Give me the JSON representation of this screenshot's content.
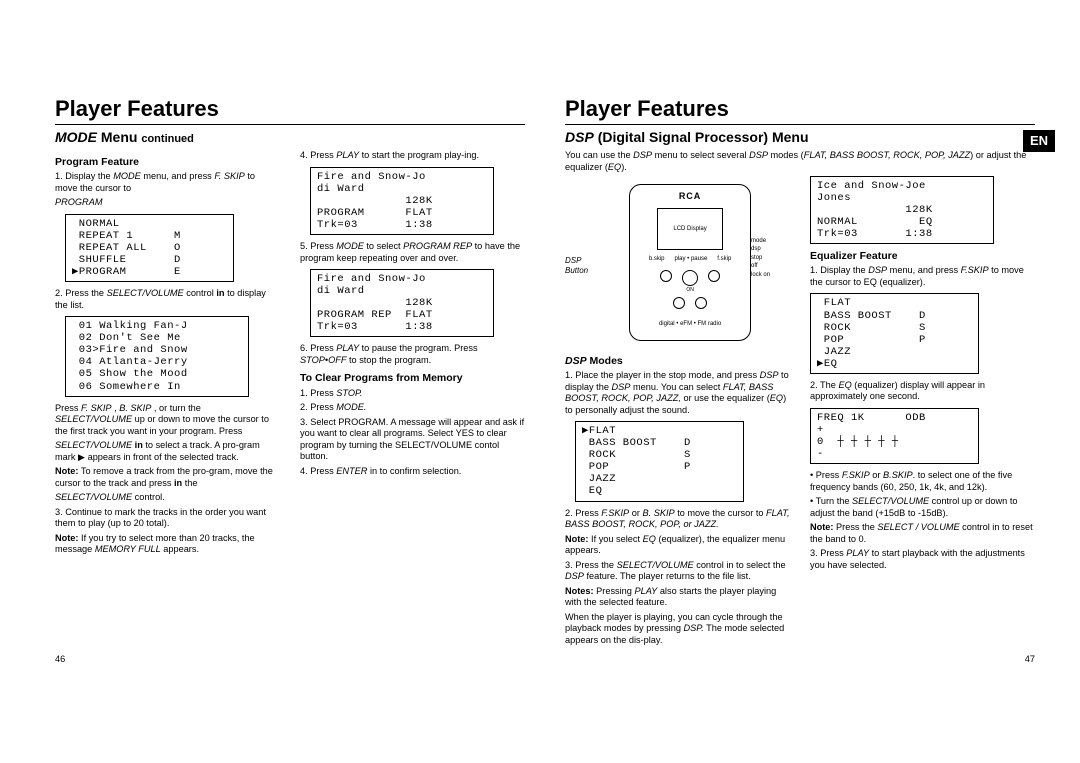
{
  "left": {
    "title": "Player Features",
    "section": "MODE Menu continued",
    "section_italic": "MODE",
    "sub_program": "Program Feature",
    "p1a": "1. Display the ",
    "p1b": "MODE",
    "p1c": " menu, and press ",
    "p1d": "F. SKIP",
    "p1e": " to move the cursor to",
    "p1f": "PROGRAM",
    "lcd1": " NORMAL\n REPEAT 1      M\n REPEAT ALL    O\n SHUFFLE       D\n▶PROGRAM       E",
    "p2a": "2. Press the ",
    "p2b": "SELECT/VOLUME",
    "p2c": " control ",
    "p2d": "in",
    "p2e": " to display the list.",
    "lcd2": " 01 Walking Fan-J\n 02 Don't See Me\n 03>Fire and Snow\n 04 Atlanta-Jerry\n 05 Show the Mood\n 06 Somewhere In",
    "p3a": "Press ",
    "p3b": "F. SKIP",
    "p3c": " , ",
    "p3d": "B. SKIP",
    "p3e": " , or turn the ",
    "p3f": "SELECT/VOLUME",
    "p3g": " up or down to move the cursor to the first track you want in your program. Press",
    "p4a": "SELECT/VOLUME",
    "p4b": " in",
    "p4c": " to select a track. A pro-gram mark ▶ appears in front of the selected track.",
    "p5a": "Note:",
    "p5b": " To remove a track from the pro-gram, move the cursor to the track and press ",
    "p5c": "in",
    "p5d": " the",
    "p5e": "SELECT/VOLUME",
    "p5f": " control.",
    "p6": "3. Continue to mark the tracks in the order you want them to play (up to 20 total).",
    "p7a": "Note:",
    "p7b": " If you try to select more than 20 tracks, the message ",
    "p7c": "MEMORY FULL",
    "p7d": " appears.",
    "r1a": "4. Press ",
    "r1b": "PLAY",
    "r1c": " to start the program play-ing.",
    "lcd3": "Fire and Snow-Jo\ndi Ward\n             128K\nPROGRAM      FLAT\nTrk=03       1:38",
    "r2a": "5. Press ",
    "r2b": "MODE",
    "r2c": " to select ",
    "r2d": "PROGRAM REP",
    "r2e": " to have the program keep repeating over and over.",
    "lcd4": "Fire and Snow-Jo\ndi Ward\n             128K\nPROGRAM REP  FLAT\nTrk=03       1:38",
    "r3a": "6. Press ",
    "r3b": "PLAY",
    "r3c": " to pause the program. Press ",
    "r3d": "STOP•OFF",
    "r3e": " to stop the program.",
    "sub_clear": "To Clear Programs from Memory",
    "c1a": "1. Press ",
    "c1b": "STOP.",
    "c2a": "2. Press ",
    "c2b": "MODE.",
    "c3": "3. Select PROGRAM. A message will appear and ask if you want to clear all programs. Select YES to clear program by turning the SELECT/VOLUME contol button.",
    "c4a": " 4. Press ",
    "c4b": "ENTER",
    "c4c": " in to confirm selection.",
    "pagenum": "46"
  },
  "right": {
    "title": "Player Features",
    "section": "DSP (Digital Signal Processor) Menu",
    "section_italic": "DSP",
    "intro1a": "You can use the ",
    "intro1b": "DSP",
    "intro1c": " menu to select several ",
    "intro1d": "DSP",
    "intro1e": " modes (",
    "intro1f": "FLAT, BASS BOOST, ROCK, POP, JAZZ",
    "intro1g": ") or adjust the equalizer (",
    "intro1h": "EQ",
    "intro1i": ").",
    "dsp_btn_label": "DSP\nButton",
    "dev_brand": "RCA",
    "dev_screen": "LCD Display",
    "dev_footer": "digital • eFM • FM radio",
    "dev_btn1": "b.skip",
    "dev_btn2": "play • pause",
    "dev_btn3": "f.skip",
    "dev_on": "ON",
    "dev_side": "mode\ndsp\nstop\noff\nlock on",
    "sub_dspmodes": "DSP Modes",
    "m1a": "1. Place the player in the stop mode, and press ",
    "m1b": "DSP",
    "m1c": " to display the ",
    "m1d": "DSP",
    "m1e": " menu. You can select ",
    "m1f": "FLAT, BASS BOOST, ROCK, POP, JAZZ,",
    "m1g": " or use the equalizer (",
    "m1h": "EQ",
    "m1i": ") to personally adjust the sound.",
    "lcd5": "▶FLAT\n BASS BOOST    D\n ROCK          S\n POP           P\n JAZZ\n EQ",
    "m2a": "2. Press ",
    "m2b": "F.SKIP",
    "m2c": " or ",
    "m2d": "B. SKIP",
    "m2e": " to move the cursor to ",
    "m2f": "FLAT, BASS BOOST, ROCK, POP, or JAZZ.",
    "m3a": "Note:",
    "m3b": " If you select ",
    "m3c": "EQ",
    "m3d": " (equalizer), the equalizer menu appears.",
    "m4a": "3. Press the ",
    "m4b": "SELECT/VOLUME",
    "m4c": " control in to select the ",
    "m4d": "DSP",
    "m4e": " feature. The player returns to the file list.",
    "m5a": "Notes:",
    "m5b": " Pressing ",
    "m5c": "PLAY",
    "m5d": " also starts the player playing with the selected feature.",
    "m6a": "When the player is playing, you can cycle through the playback modes by pressing ",
    "m6b": "DSP.",
    "m6c": " The mode selected appears on the dis-play.",
    "lcd6": "Ice and Snow-Joe\nJones\n             128K\nNORMAL         EQ\nTrk=03       1:38",
    "sub_eq": "Equalizer Feature",
    "e1a": "1. Display the ",
    "e1b": "DSP",
    "e1c": " menu, and press ",
    "e1d": "F.SKIP",
    "e1e": " to move the cursor to EQ (equalizer).",
    "lcd7": " FLAT\n BASS BOOST    D\n ROCK          S\n POP           P\n JAZZ\n▶EQ",
    "e2a": "2. The ",
    "e2b": "EQ",
    "e2c": " (equalizer) display will appear in approximately one second.",
    "lcd8": "FREQ 1K      ODB\n+\n0  ┼ ┼ ┼ ┼ ┼\n-",
    "e3a": "• Press ",
    "e3b": "F.SKIP",
    "e3c": " or ",
    "e3d": "B.SKIP",
    "e3e": ". to select one of the five frequency bands (60, 250, 1k, 4k, and 12k).",
    "e4a": "• Turn the ",
    "e4b": "SELECT/VOLUME",
    "e4c": " control up or down to adjust the band (+15dB to -15dB).",
    "e5a": "Note:",
    "e5b": " Press the ",
    "e5c": "SELECT / VOLUME",
    "e5d": " control in to reset the band to 0.",
    "e6a": "3. Press ",
    "e6b": "PLAY",
    "e6c": " to start playback with the adjustments you have selected.",
    "pagenum": "47",
    "en": "EN"
  }
}
